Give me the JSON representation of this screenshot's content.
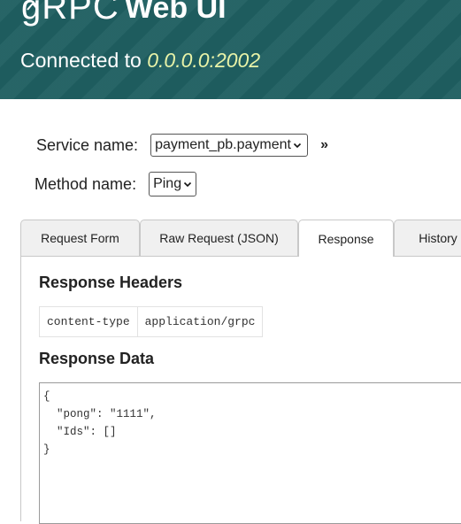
{
  "header": {
    "logo_text": "gRPC",
    "title": "Web UI",
    "connected_prefix": "Connected to",
    "address": "0.0.0.0:2002",
    "background_color": "#1f5f61",
    "address_color": "#e8f3a8"
  },
  "service": {
    "label": "Service name:",
    "selected": "payment_pb.payment",
    "expand_glyph": "»"
  },
  "method": {
    "label": "Method name:",
    "selected": "Ping"
  },
  "tabs": [
    {
      "label": "Request Form",
      "active": false
    },
    {
      "label": "Raw Request (JSON)",
      "active": false
    },
    {
      "label": "Response",
      "active": true
    },
    {
      "label": "History",
      "active": false
    }
  ],
  "response": {
    "headers_title": "Response Headers",
    "headers": [
      {
        "name": "content-type",
        "value": "application/grpc"
      }
    ],
    "data_title": "Response Data",
    "data_lines": [
      "{",
      "  \"pong\": \"1111\",",
      "  \"Ids\": []",
      "}"
    ]
  }
}
